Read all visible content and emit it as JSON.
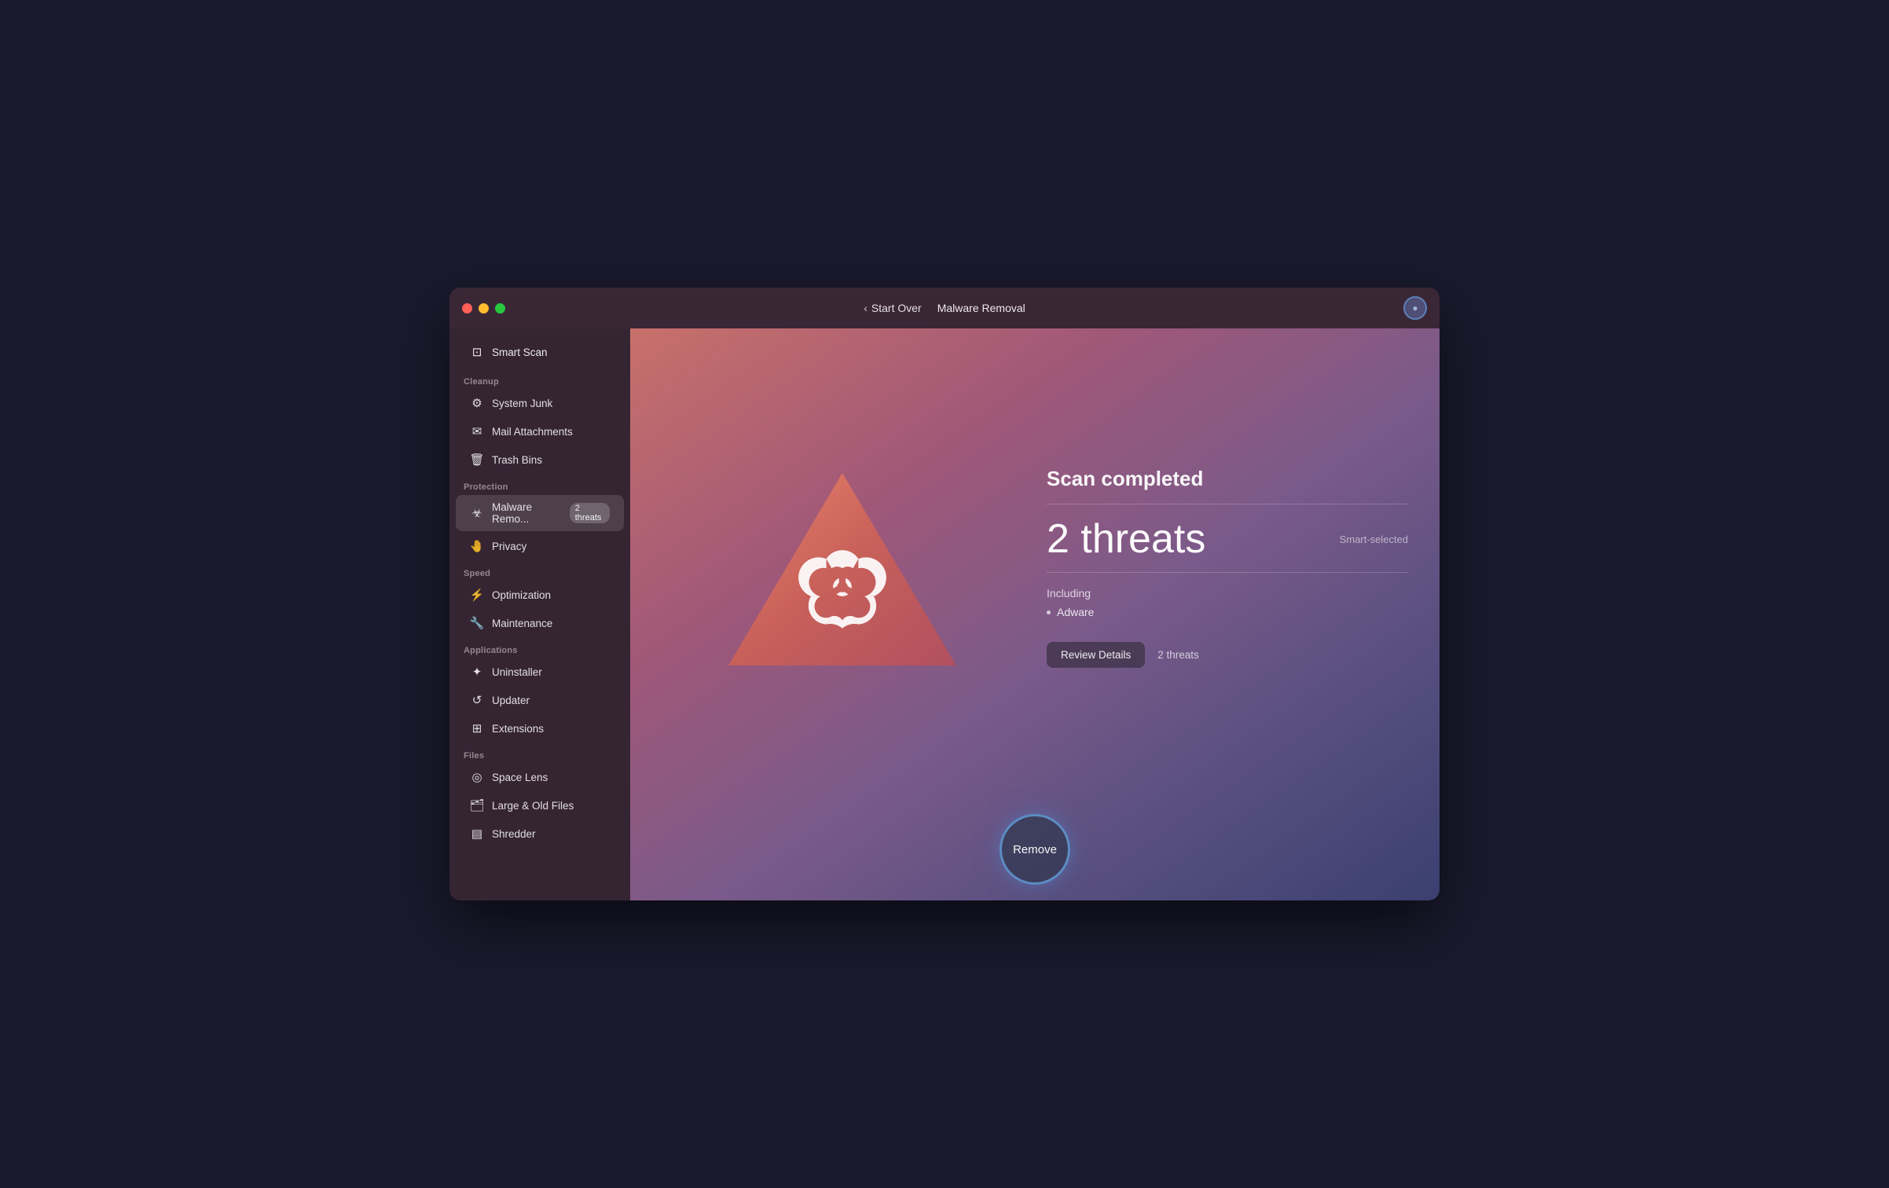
{
  "window": {
    "title": "Malware Removal"
  },
  "titlebar": {
    "start_over": "Start Over",
    "title": "Malware Removal"
  },
  "sidebar": {
    "smart_scan": "Smart Scan",
    "cleanup_label": "Cleanup",
    "system_junk": "System Junk",
    "mail_attachments": "Mail Attachments",
    "trash_bins": "Trash Bins",
    "protection_label": "Protection",
    "malware_removal": "Malware Remo...",
    "malware_badge": "2 threats",
    "privacy": "Privacy",
    "speed_label": "Speed",
    "optimization": "Optimization",
    "maintenance": "Maintenance",
    "applications_label": "Applications",
    "uninstaller": "Uninstaller",
    "updater": "Updater",
    "extensions": "Extensions",
    "files_label": "Files",
    "space_lens": "Space Lens",
    "large_old_files": "Large & Old Files",
    "shredder": "Shredder"
  },
  "content": {
    "scan_completed": "Scan completed",
    "threats_count": "2 threats",
    "smart_selected": "Smart-selected",
    "including_label": "Including",
    "adware": "Adware",
    "review_details": "Review Details",
    "review_threats": "2 threats",
    "remove_label": "Remove"
  }
}
